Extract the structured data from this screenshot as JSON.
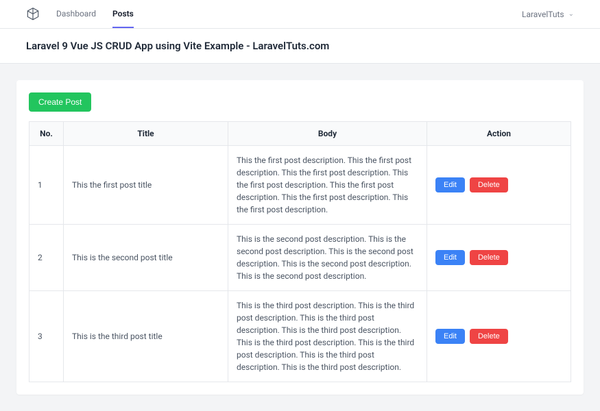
{
  "nav": {
    "links": [
      {
        "label": "Dashboard",
        "active": false
      },
      {
        "label": "Posts",
        "active": true
      }
    ],
    "user_label": "LaravelTuts"
  },
  "page": {
    "title": "Laravel 9 Vue JS CRUD App using Vite Example - LaravelTuts.com"
  },
  "buttons": {
    "create": "Create Post",
    "edit": "Edit",
    "delete": "Delete"
  },
  "table": {
    "headers": {
      "no": "No.",
      "title": "Title",
      "body": "Body",
      "action": "Action"
    },
    "rows": [
      {
        "no": "1",
        "title": "This the first post title",
        "body": "This the first post description. This the first post description. This the first post description. This the first post description. This the first post description. This the first post description. This the first post description."
      },
      {
        "no": "2",
        "title": "This is the second post title",
        "body": "This is the second post description. This is the second post description. This is the second post description. This is the second post description. This is the second post description."
      },
      {
        "no": "3",
        "title": "This is the third post title",
        "body": "This is the third post description. This is the third post description. This is the third post description. This is the third post description. This is the third post description. This is the third post description. This is the third post description. This is the third post description."
      }
    ]
  }
}
